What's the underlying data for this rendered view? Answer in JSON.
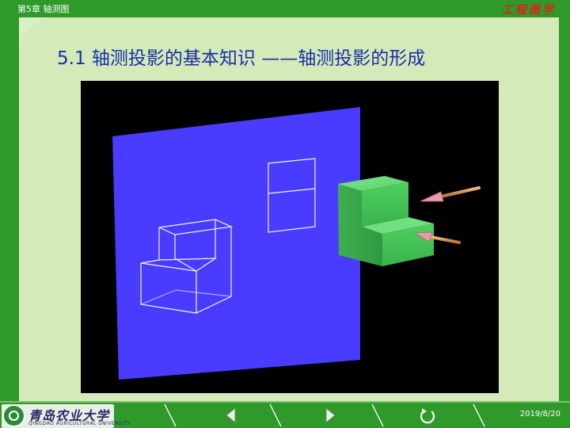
{
  "header": {
    "chapter": "第5章  轴测图",
    "brand": "工程图学"
  },
  "slide": {
    "title": "5.1 轴测投影的基本知识 ——轴测投影的形成"
  },
  "footer": {
    "logo_text": "青岛农业大学",
    "logo_subtext": "QINGDAO AGRICULTURAL UNIVERSITY",
    "date": "2019/8/20"
  },
  "colors": {
    "bar": "#2f9a2a",
    "title": "#1a2ea8",
    "plane": "#4a3cff",
    "block": "#55d46a",
    "brand": "#e02020"
  },
  "icons": {
    "prev": "triangle-left-icon",
    "next": "triangle-right-icon",
    "return": "circular-arrow-icon"
  }
}
